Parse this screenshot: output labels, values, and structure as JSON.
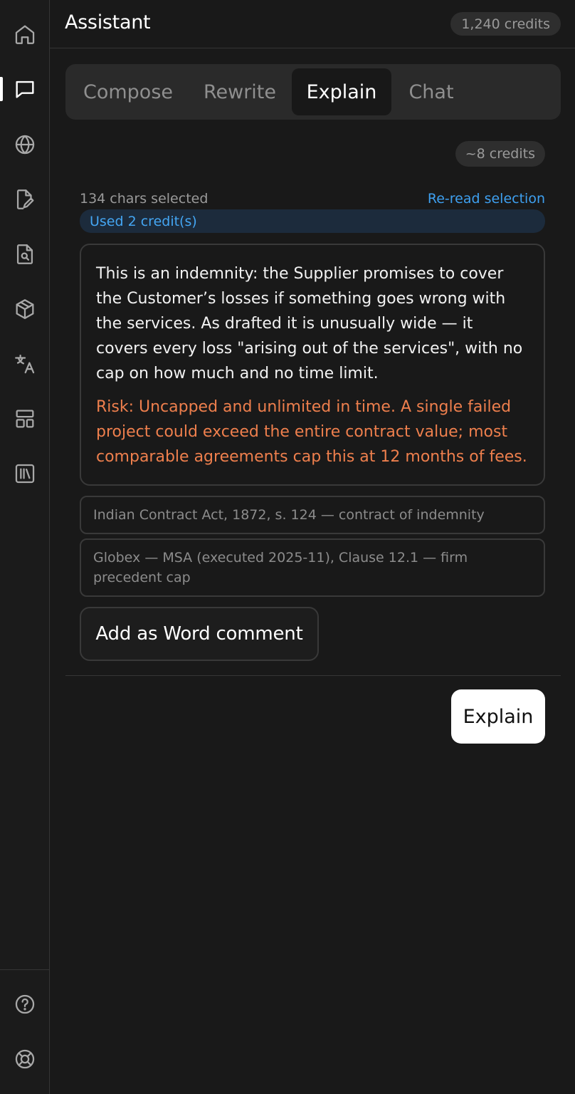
{
  "header": {
    "title": "Assistant",
    "credits": "1,240 credits"
  },
  "rail": {
    "items": [
      {
        "icon": "home-icon",
        "active": false
      },
      {
        "icon": "chat-icon",
        "active": true
      },
      {
        "icon": "globe-icon",
        "active": false
      },
      {
        "icon": "document-edit-icon",
        "active": false
      },
      {
        "icon": "document-search-icon",
        "active": false
      },
      {
        "icon": "package-icon",
        "active": false
      },
      {
        "icon": "translate-icon",
        "active": false
      },
      {
        "icon": "layout-icon",
        "active": false
      },
      {
        "icon": "library-icon",
        "active": false
      }
    ],
    "bottom": [
      {
        "icon": "help-icon"
      },
      {
        "icon": "support-icon"
      }
    ]
  },
  "tabs": [
    {
      "label": "Compose",
      "active": false
    },
    {
      "label": "Rewrite",
      "active": false
    },
    {
      "label": "Explain",
      "active": true
    },
    {
      "label": "Chat",
      "active": false
    }
  ],
  "explain": {
    "cost": "~8 credits",
    "selection": "134 chars selected",
    "reread": "Re-read selection",
    "used": "Used 2 credit(s)",
    "explanation": "This is an indemnity: the Supplier promises to cover the Customer’s losses if something goes wrong with the services. As drafted it is unusually wide — it covers every loss \"arising out of the services\", with no cap on how much and no time limit.",
    "risk": "Risk: Uncapped and unlimited in time. A single failed project could exceed the entire contract value; most comparable agreements cap this at 12 months of fees.",
    "references": [
      "Indian Contract Act, 1872, s. 124 — contract of indemnity",
      "Globex — MSA (executed 2025-11), Clause 12.1 — firm precedent cap"
    ],
    "add_comment": "Add as Word comment",
    "submit": "Explain"
  },
  "colors": {
    "background": "#191919",
    "link": "#3ea0f0",
    "risk": "#ee7f4d",
    "primary_button": "#ffffff"
  }
}
